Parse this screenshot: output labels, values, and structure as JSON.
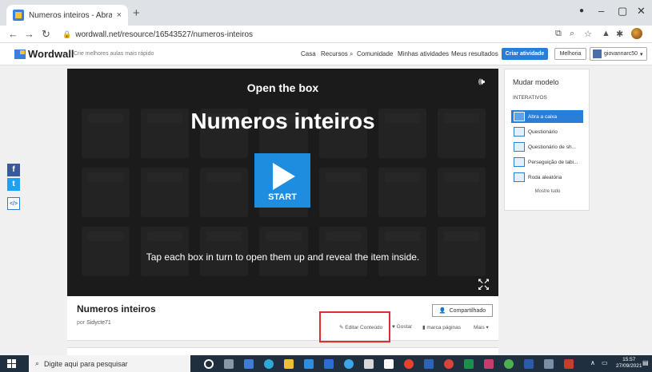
{
  "browser": {
    "tab_title": "Numeros inteiros - Abra a caixa",
    "tab_close": "×",
    "new_tab": "+",
    "url": "wordwall.net/resource/16543527/numeros-inteiros",
    "window_controls": [
      "–",
      "▢",
      "✕"
    ]
  },
  "site": {
    "logo": "Wordwall",
    "tagline": "Crie melhores aulas mais rápido",
    "nav": [
      "Casa",
      "Recursos",
      "Comunidade",
      "Minhas atividades",
      "Meus resultados"
    ],
    "create_button": "Criar atividade",
    "upgrade_button": "Melhoria",
    "username": "giovannarc50",
    "accent_color": "#2a7ed6"
  },
  "social": [
    "f",
    "t",
    "</>"
  ],
  "game": {
    "subtitle": "Open the box",
    "title": "Numeros inteiros",
    "start_label": "START",
    "instructions": "Tap each box in turn to open them up and reveal the item inside."
  },
  "activity": {
    "name": "Numeros inteiros",
    "author_prefix": "por",
    "author": "Sidycte71",
    "share_label": "Compartilhado",
    "actions": {
      "edit": "Editar Conteúdo",
      "like": "Gostar",
      "bookmark": "marca páginas",
      "more": "Mais"
    }
  },
  "templates_panel": {
    "heading": "Mudar modelo",
    "section": "INTERATIVOS",
    "items": [
      "Abra a caixa",
      "Questionário",
      "Questionário de sh...",
      "Perseguição de labi...",
      "Roda aleatória"
    ],
    "active_index": 0,
    "more_label": "Mostre tudo"
  },
  "taskbar": {
    "search_placeholder": "Digite aqui para pesquisar",
    "time": "15:57",
    "date": "27/09/2021"
  }
}
